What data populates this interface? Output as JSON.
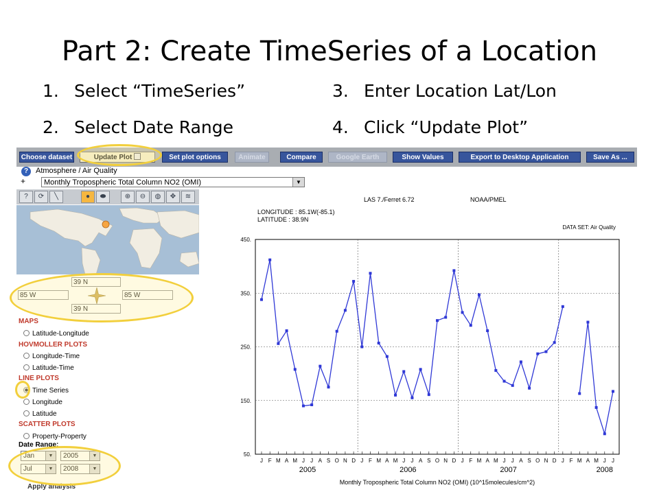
{
  "slide": {
    "title": "Part 2: Create TimeSeries of a Location",
    "steps": [
      {
        "num": "1.",
        "text": "Select “TimeSeries”"
      },
      {
        "num": "3.",
        "text": "Enter Location Lat/Lon"
      },
      {
        "num": "2.",
        "text": "Select Date Range"
      },
      {
        "num": "4.",
        "text": "Click “Update Plot”"
      }
    ]
  },
  "toolbar": {
    "buttons": [
      {
        "label": "Choose dataset"
      },
      {
        "label": "Update Plot"
      },
      {
        "label": "Set plot options"
      },
      {
        "label": "Animate"
      },
      {
        "label": "Compare"
      },
      {
        "label": "Google Earth"
      },
      {
        "label": "Show Values"
      },
      {
        "label": "Export to Desktop Application"
      },
      {
        "label": "Save As ..."
      }
    ]
  },
  "dataset": {
    "category": "Atmosphere / Air Quality",
    "plus": "+",
    "help": "?",
    "selected": "Monthly Tropospheric Total Column NO2 (OMI)"
  },
  "coords": {
    "north": "39 N",
    "west": "85 W",
    "east": "85 W",
    "south": "39 N"
  },
  "panel": {
    "maps_header": "MAPS",
    "lat_lon": "Latitude-Longitude",
    "hov_header": "HOVMOLLER PLOTS",
    "lon_time": "Longitude-Time",
    "lat_time": "Latitude-Time",
    "line_header": "LINE PLOTS",
    "time_series": "Time Series",
    "longitude": "Longitude",
    "latitude": "Latitude",
    "scatter_header": "SCATTER PLOTS",
    "prop_prop": "Property-Property",
    "date_range_label": "Date Range:",
    "start_month": "Jan",
    "start_year": "2005",
    "end_month": "Jul",
    "end_year": "2008",
    "apply": "Apply analysis"
  },
  "plot_header": {
    "software": "LAS 7./Ferret 6.72",
    "org": "NOAA/PMEL",
    "longitude": "LONGITUDE : 85.1W(-85.1)",
    "latitude": "LATITUDE : 38.9N",
    "dataset": "DATA SET: Air Quality"
  },
  "chart_data": {
    "type": "line",
    "title": "",
    "xlabel": "Monthly Tropospheric Total Column NO2 (OMI) (10^15molecules/cm^2)",
    "ylabel": "",
    "ylim": [
      50,
      450
    ],
    "yticks": [
      50,
      150,
      250,
      350,
      450
    ],
    "ytick_labels": [
      "50.",
      "150.",
      "250.",
      "350.",
      "450."
    ],
    "grid": true,
    "month_labels": [
      "J",
      "F",
      "M",
      "A",
      "M",
      "J",
      "J",
      "A",
      "S",
      "O",
      "N",
      "D",
      "J",
      "F",
      "M",
      "A",
      "M",
      "J",
      "J",
      "A",
      "S",
      "O",
      "N",
      "D",
      "J",
      "F",
      "M",
      "A",
      "M",
      "J",
      "J",
      "A",
      "S",
      "O",
      "N",
      "D",
      "J",
      "F",
      "M",
      "A",
      "M",
      "J",
      "J"
    ],
    "year_labels": [
      "2005",
      "2006",
      "2007",
      "2008"
    ],
    "year_label_month_index": [
      5.5,
      17.5,
      29.5,
      41
    ],
    "series": [
      {
        "color": "#2f38d6",
        "values": [
          338,
          412,
          256,
          280,
          208,
          140,
          142,
          214,
          175,
          279,
          318,
          372,
          250,
          387,
          257,
          232,
          160,
          204,
          155,
          208,
          161,
          299,
          305,
          392,
          314,
          290,
          347,
          280,
          206,
          186,
          178,
          222,
          173,
          237,
          241,
          258,
          325,
          null,
          163,
          296,
          137,
          88,
          167
        ]
      }
    ]
  }
}
